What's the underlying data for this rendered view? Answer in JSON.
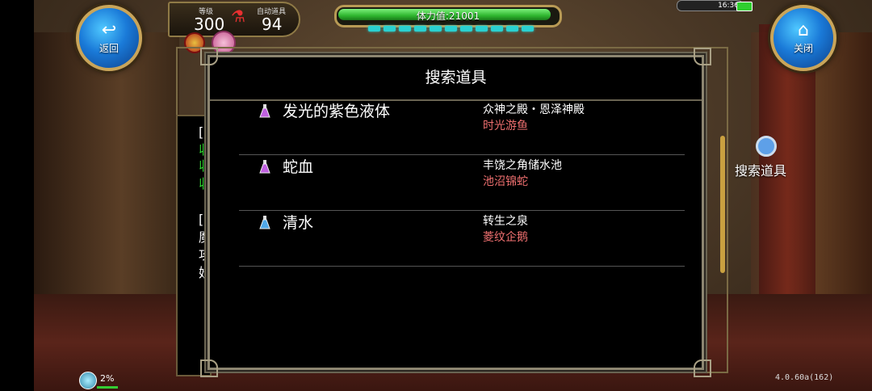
{
  "top_bar": {
    "back_label": "返回",
    "close_label": "关闭",
    "level_label": "等级",
    "level_value": "300",
    "auto_item_label": "自动道具",
    "auto_item_value": "94",
    "stamina_text": "体力值:21001",
    "stamina_fraction": 0.98,
    "clock": "16:36"
  },
  "side": {
    "search_label": "搜索道具"
  },
  "left_log_lines": [
    {
      "text": "[",
      "color": "#ffffff"
    },
    {
      "text": "収",
      "color": "#33dd33"
    },
    {
      "text": "収",
      "color": "#33dd33"
    },
    {
      "text": "収",
      "color": "#33dd33"
    },
    {
      "text": "[",
      "color": "#ffffff"
    },
    {
      "text": "魔",
      "color": "#ffffff"
    },
    {
      "text": "攻",
      "color": "#ffffff"
    },
    {
      "text": "妖",
      "color": "#ffffff"
    }
  ],
  "dialog": {
    "title": "搜索道具",
    "items": [
      {
        "name": "发光的紫色液体",
        "location": "众神之殿・恩泽神殿",
        "monster": "时光游鱼",
        "potion_color": "#c060e0"
      },
      {
        "name": "蛇血",
        "location": "丰饶之角储水池",
        "monster": "池沼锦蛇",
        "potion_color": "#c060e0"
      },
      {
        "name": "清水",
        "location": "转生之泉",
        "monster": "菱纹企鹅",
        "potion_color": "#50a8e8"
      }
    ]
  },
  "footer": {
    "network_percent": "2%",
    "version": "4.0.60a(162)"
  },
  "colors": {
    "stamina_green": "#2fb62f",
    "monster_red": "#f07070",
    "button_blue": "#1a7ad8"
  }
}
